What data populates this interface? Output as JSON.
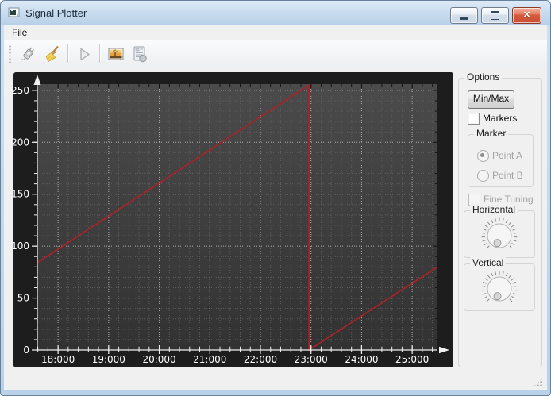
{
  "window": {
    "title": "Signal Plotter"
  },
  "icons": {
    "close_glyph": "✕"
  },
  "menubar": {
    "items": [
      {
        "label": "File"
      }
    ]
  },
  "toolbar": {
    "buttons": [
      {
        "name": "connect",
        "icon": "plug-icon",
        "enabled": false
      },
      {
        "name": "clear",
        "icon": "broom-icon",
        "enabled": true
      },
      {
        "name": "start",
        "icon": "play-icon",
        "enabled": false
      },
      {
        "name": "snapshot",
        "icon": "screenshot-icon",
        "enabled": true
      },
      {
        "name": "report",
        "icon": "report-icon",
        "enabled": false
      }
    ]
  },
  "options_panel": {
    "title": "Options",
    "minmax_button": "Min/Max",
    "markers_checkbox": {
      "label": "Markers",
      "checked": false
    },
    "marker_group": {
      "title": "Marker",
      "point_a": {
        "label": "Point A",
        "selected": true,
        "enabled": false
      },
      "point_b": {
        "label": "Point B",
        "selected": false,
        "enabled": false
      }
    },
    "fine_tuning_checkbox": {
      "label": "Fine Tuning",
      "checked": false,
      "enabled": false
    },
    "horizontal_group": {
      "title": "Horizontal"
    },
    "vertical_group": {
      "title": "Vertical"
    }
  },
  "chart_data": {
    "type": "line",
    "title": "",
    "xlabel": "",
    "ylabel": "",
    "xlim": [
      17.59,
      25.5
    ],
    "ylim": [
      0,
      256
    ],
    "x_tick_values": [
      18,
      19,
      20,
      21,
      22,
      23,
      24,
      25
    ],
    "x_tick_labels": [
      "18:000",
      "19:000",
      "20:000",
      "21:000",
      "22:000",
      "23:000",
      "24:000",
      "25:000"
    ],
    "y_tick_values": [
      0,
      50,
      100,
      150,
      200,
      250
    ],
    "y_tick_labels": [
      "0",
      "50",
      "100",
      "150",
      "200",
      "250"
    ],
    "x_minor_step": 0.2,
    "y_minor_step": 10,
    "grid": true,
    "legend": false,
    "canvas_color_top": "#4b4b4b",
    "canvas_color_bottom": "#323232",
    "major_grid_color": "#a8a8a8",
    "minor_grid_color": "#5c5c5c",
    "axis_color": "#efefef",
    "series": [
      {
        "name": "signal",
        "color": "#b02025",
        "points": [
          [
            17.59,
            84
          ],
          [
            22.96,
            255
          ],
          [
            22.96,
            0
          ],
          [
            25.5,
            80
          ]
        ]
      }
    ]
  }
}
